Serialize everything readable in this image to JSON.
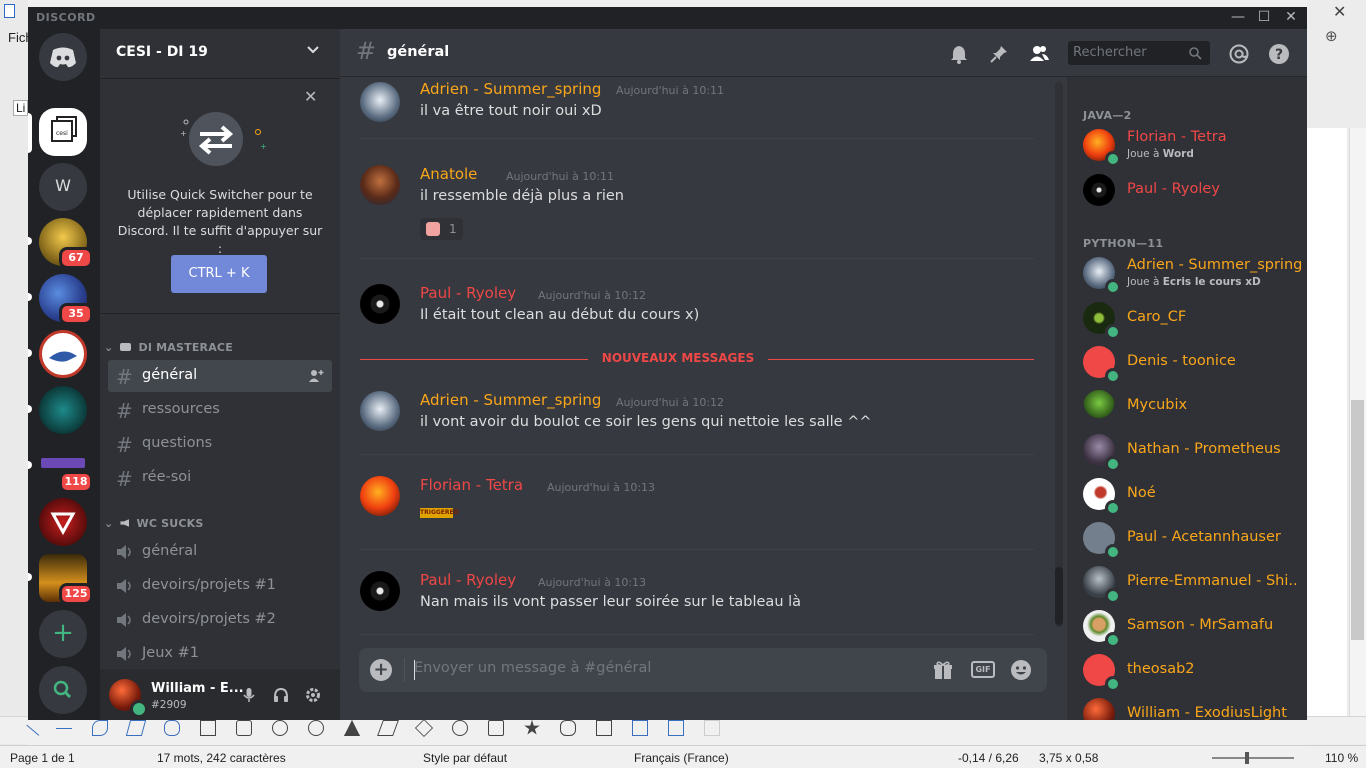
{
  "background": {
    "menu_partial": "Fich",
    "style_box_partial": "Li",
    "status": {
      "page": "Page 1 de 1",
      "words": "17 mots, 242 caractères",
      "style": "Style par défaut",
      "language": "Français (France)",
      "position": "-0,14 / 6,26",
      "size": "3,75 x 0,58",
      "zoom": "110 %"
    }
  },
  "titlebar": {
    "brand": "DISCORD",
    "minimize": "—",
    "maximize": "☐",
    "close": "✕"
  },
  "guilds": [
    {
      "id": "home",
      "label": "",
      "badge": ""
    },
    {
      "id": "cesi",
      "label": "cesi",
      "badge": ""
    },
    {
      "id": "w",
      "label": "W",
      "badge": ""
    },
    {
      "id": "g3",
      "label": "",
      "badge": "67"
    },
    {
      "id": "g4",
      "label": "",
      "badge": "35"
    },
    {
      "id": "g5",
      "label": "",
      "badge": ""
    },
    {
      "id": "g6",
      "label": "",
      "badge": ""
    },
    {
      "id": "g7",
      "label": "",
      "badge": "118"
    },
    {
      "id": "g8",
      "label": "",
      "badge": ""
    },
    {
      "id": "g9",
      "label": "",
      "badge": "125"
    }
  ],
  "sidebar": {
    "server_name": "CESI - DI 19",
    "quick_switcher": {
      "text": "Utilise Quick Switcher pour te déplacer rapidement dans Discord. Il te suffit d'appuyer sur :",
      "button": "CTRL + K"
    },
    "categories": [
      {
        "name": "DI MASTERACE",
        "channels": [
          "général",
          "ressources",
          "questions",
          "rée-soi"
        ]
      },
      {
        "name": "WC SUCKS",
        "channels": [
          "général",
          "devoirs/projets #1",
          "devoirs/projets #2",
          "Jeux #1"
        ]
      }
    ]
  },
  "user": {
    "name": "William - E...",
    "tag": "#2909"
  },
  "chat": {
    "channel": "général",
    "search_placeholder": "Rechercher",
    "new_messages_label": "NOUVEAUX MESSAGES",
    "composer_placeholder": "Envoyer un message à #général",
    "messages": [
      {
        "author": "Adrien - Summer_spring",
        "color": "#faa61a",
        "time": "Aujourd'hui à 10:11",
        "text": "il va être tout noir oui xD"
      },
      {
        "author": "Anatole",
        "color": "#faa61a",
        "time": "Aujourd'hui à 10:11",
        "text": "il ressemble déjà plus a rien",
        "reaction_count": "1"
      },
      {
        "author": "Paul - Ryoley",
        "color": "#f04747",
        "time": "Aujourd'hui à 10:12",
        "text": "Il était tout clean au début du cours x)"
      },
      {
        "author": "Adrien - Summer_spring",
        "color": "#faa61a",
        "time": "Aujourd'hui à 10:12",
        "text": "il vont avoir du boulot ce soir les gens qui nettoie les salle ^^"
      },
      {
        "author": "Florian - Tetra",
        "color": "#f04747",
        "time": "Aujourd'hui à 10:13",
        "text": "",
        "image_text": "TRIGGERED"
      },
      {
        "author": "Paul - Ryoley",
        "color": "#f04747",
        "time": "Aujourd'hui à 10:13",
        "text": "Nan mais ils vont passer leur soirée sur le tableau là"
      }
    ]
  },
  "members": {
    "groups": [
      {
        "name": "JAVA—2",
        "members": [
          {
            "name": "Florian - Tetra",
            "color": "#f04747",
            "activity_prefix": "Joue à ",
            "activity": "Word"
          },
          {
            "name": "Paul - Ryoley",
            "color": "#f04747"
          }
        ]
      },
      {
        "name": "PYTHON—11",
        "members": [
          {
            "name": "Adrien - Summer_spring",
            "color": "#faa61a",
            "activity_prefix": "Joue à ",
            "activity": "Ecris le cours xD"
          },
          {
            "name": "Caro_CF",
            "color": "#faa61a"
          },
          {
            "name": "Denis - toonice",
            "color": "#faa61a"
          },
          {
            "name": "Mycubix",
            "color": "#faa61a"
          },
          {
            "name": "Nathan - Prometheus",
            "color": "#faa61a"
          },
          {
            "name": "Noé",
            "color": "#faa61a"
          },
          {
            "name": "Paul - Acetannhauser",
            "color": "#faa61a"
          },
          {
            "name": "Pierre-Emmanuel - Shi...",
            "color": "#faa61a"
          },
          {
            "name": "Samson - MrSamafu",
            "color": "#faa61a"
          },
          {
            "name": "theosab2",
            "color": "#faa61a"
          },
          {
            "name": "William - ExodiusLight",
            "color": "#faa61a"
          }
        ]
      }
    ]
  },
  "colors": {
    "accent": "#7289da",
    "online": "#43b581",
    "red": "#f04747",
    "orange": "#faa61a"
  }
}
